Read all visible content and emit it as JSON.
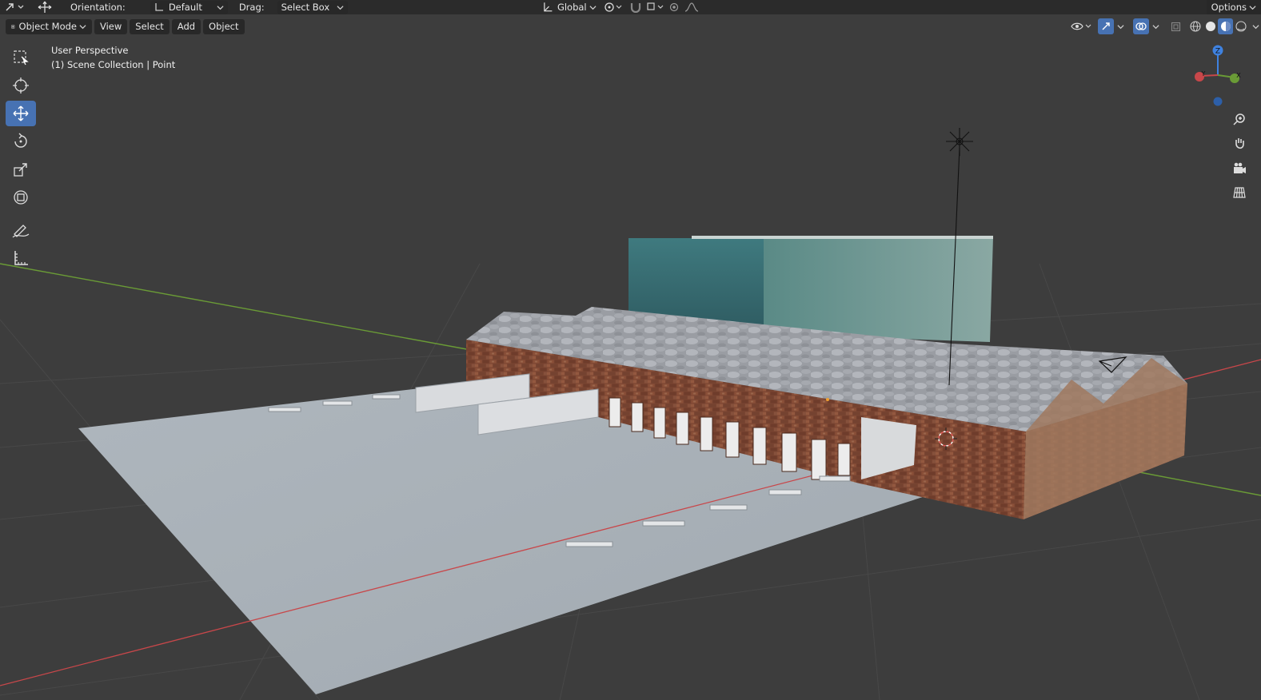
{
  "topbar": {
    "orientation_label": "Orientation:",
    "orientation_value": "Default",
    "drag_label": "Drag:",
    "drag_value": "Select Box",
    "transform_space": "Global",
    "options_label": "Options"
  },
  "header": {
    "mode": "Object Mode",
    "menus": [
      "View",
      "Select",
      "Add",
      "Object"
    ]
  },
  "viewport": {
    "view_name": "User Perspective",
    "collection_info": "(1) Scene Collection | Point"
  },
  "gizmo": {
    "z": "Z",
    "y": "Y",
    "x": "X"
  },
  "colors": {
    "accent": "#4772b3",
    "x_axis": "#c8474a",
    "y_axis": "#6a9b36",
    "z_axis": "#3f82e0"
  },
  "toolbar_icons": [
    "select-box-icon",
    "cursor-icon",
    "move-icon",
    "rotate-icon",
    "scale-icon",
    "transform-icon",
    "annotate-icon",
    "measure-icon"
  ],
  "nav_icons": [
    "zoom-icon",
    "pan-hand-icon",
    "camera-icon",
    "ortho-grid-icon"
  ]
}
